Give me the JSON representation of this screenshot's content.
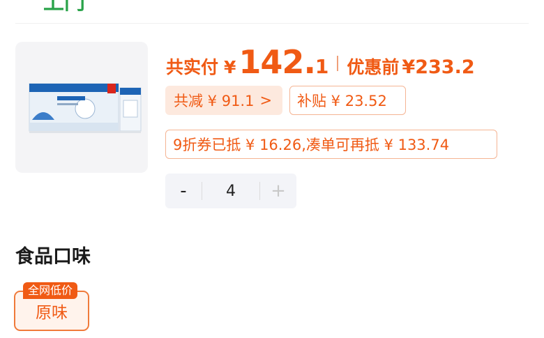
{
  "top_label": "上门",
  "price": {
    "paid_label": "共实付",
    "yen": "¥",
    "paid_int": "142.",
    "paid_dec": "1",
    "orig_label": "优惠前",
    "orig_value": "¥233.2"
  },
  "chips": {
    "reduce_text": "共减 ¥ 91.1",
    "reduce_arrow": ">",
    "subsidy_text": "补贴 ¥ 23.52",
    "coupon_text": "9折券已抵 ¥ 16.26,凑单可再抵 ¥ 133.74"
  },
  "stepper": {
    "minus": "-",
    "value": "4",
    "plus": "+"
  },
  "flavor": {
    "section_title": "食品口味",
    "option_label": "原味",
    "option_tag": "全网低价"
  },
  "colors": {
    "accent": "#f05a14",
    "green": "#2aa34a"
  },
  "icons": {
    "product": "milk-box-product-image"
  }
}
